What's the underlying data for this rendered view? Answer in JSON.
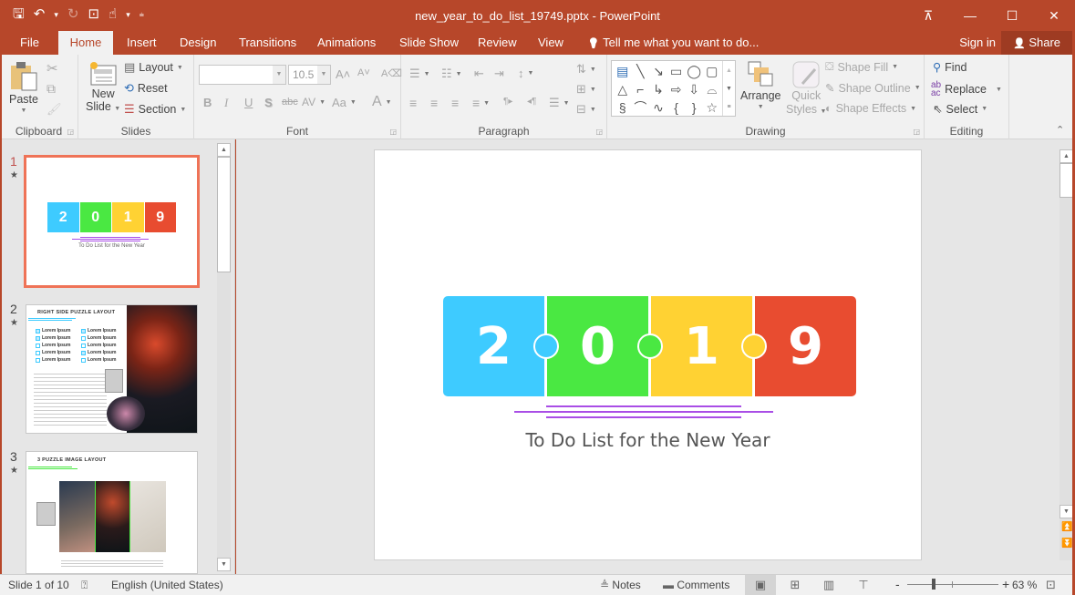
{
  "titlebar": {
    "title": "new_year_to_do_list_19749.pptx - PowerPoint",
    "qat": {
      "save": "🖫",
      "undo": "↶",
      "undo_caret": "▾",
      "redo": "↻",
      "present": "⊡",
      "touch": "☝",
      "touch_caret": "▾",
      "customize": "⩧"
    },
    "window": {
      "ribbon_options": "⊼",
      "minimize": "—",
      "maximize": "☐",
      "close": "✕"
    }
  },
  "tabs": [
    {
      "label": "File"
    },
    {
      "label": "Home"
    },
    {
      "label": "Insert"
    },
    {
      "label": "Design"
    },
    {
      "label": "Transitions"
    },
    {
      "label": "Animations"
    },
    {
      "label": "Slide Show"
    },
    {
      "label": "Review"
    },
    {
      "label": "View"
    }
  ],
  "tell_me": {
    "icon": "💡",
    "text": "Tell me what you want to do..."
  },
  "account": {
    "sign_in": "Sign in",
    "share": "Share",
    "share_icon": "👤"
  },
  "ribbon": {
    "clipboard": {
      "label": "Clipboard",
      "paste": "Paste",
      "cut_icon": "✂",
      "copy_icon": "⧉",
      "format_painter_icon": "🖌"
    },
    "slides": {
      "label": "Slides",
      "new_slide_1": "New",
      "new_slide_2": "Slide",
      "layout": "Layout",
      "reset": "Reset",
      "section": "Section"
    },
    "font": {
      "label": "Font",
      "font_name": "",
      "font_size": "10.5",
      "grow": "A˄",
      "shrink": "A˅",
      "clear": "A⌫",
      "bold": "B",
      "italic": "I",
      "underline": "U",
      "shadow": "S",
      "strike": "abc",
      "spacing": "AV",
      "case": "Aa",
      "color": "A"
    },
    "paragraph": {
      "label": "Paragraph",
      "bullets": "☰",
      "numbering": "☷",
      "dec_indent": "⇤",
      "inc_indent": "⇥",
      "line_spacing": "↕",
      "text_dir": "⇅",
      "align_left": "≡",
      "center": "≡",
      "align_right": "≡",
      "justify": "≡",
      "ltr": "¶▸",
      "rtl": "◂¶",
      "columns": "☰",
      "align_text": "⊞",
      "smartart": "⊟"
    },
    "drawing": {
      "label": "Drawing",
      "shapes": [
        "▤",
        "╲",
        "↘",
        "▭",
        "◯",
        "▢",
        "△",
        "⌐",
        "↳",
        "⇨",
        "⇩",
        "⌓",
        "§",
        "⌒",
        "∿",
        "{",
        "}",
        "☆"
      ],
      "arrange": "Arrange",
      "quick_styles_1": "Quick",
      "quick_styles_2": "Styles",
      "shape_fill": "Shape Fill",
      "shape_outline": "Shape Outline",
      "shape_effects": "Shape Effects"
    },
    "editing": {
      "label": "Editing",
      "find": "Find",
      "replace": "Replace",
      "select": "Select"
    }
  },
  "thumbnails": [
    {
      "number": "1",
      "title": "To Do List for the New Year",
      "digits": [
        "2",
        "0",
        "1",
        "9"
      ]
    },
    {
      "number": "2",
      "title": "RIGHT SIDE PUZZLE LAYOUT",
      "items": [
        "Lorem Ipsum",
        "Lorem Ipsum",
        "Lorem Ipsum",
        "Lorem Ipsum",
        "Lorem Ipsum",
        "Lorem Ipsum",
        "Lorem Ipsum",
        "Lorem Ipsum",
        "Lorem Ipsum",
        "Lorem Ipsum"
      ]
    },
    {
      "number": "3",
      "title": "3 PUZZLE IMAGE LAYOUT"
    }
  ],
  "slide": {
    "digits": [
      {
        "text": "2",
        "color": "#3ecbff"
      },
      {
        "text": "0",
        "color": "#4ae842"
      },
      {
        "text": "1",
        "color": "#ffd233"
      },
      {
        "text": "9",
        "color": "#e84c30"
      }
    ],
    "accent_line_color": "#a94ee6",
    "subtitle": "To Do List for the New Year"
  },
  "status": {
    "slide_info": "Slide 1 of 10",
    "spellcheck_icon": "⍰",
    "language": "English (United States)",
    "notes": "Notes",
    "comments": "Comments",
    "zoom_minus": "-",
    "zoom_plus": "+",
    "zoom_level": "63 %",
    "zoom_percent": 63,
    "fit_icon": "⊡"
  },
  "colors": {
    "brand": "#b7472a",
    "selected_thumb": "#ef7357"
  }
}
